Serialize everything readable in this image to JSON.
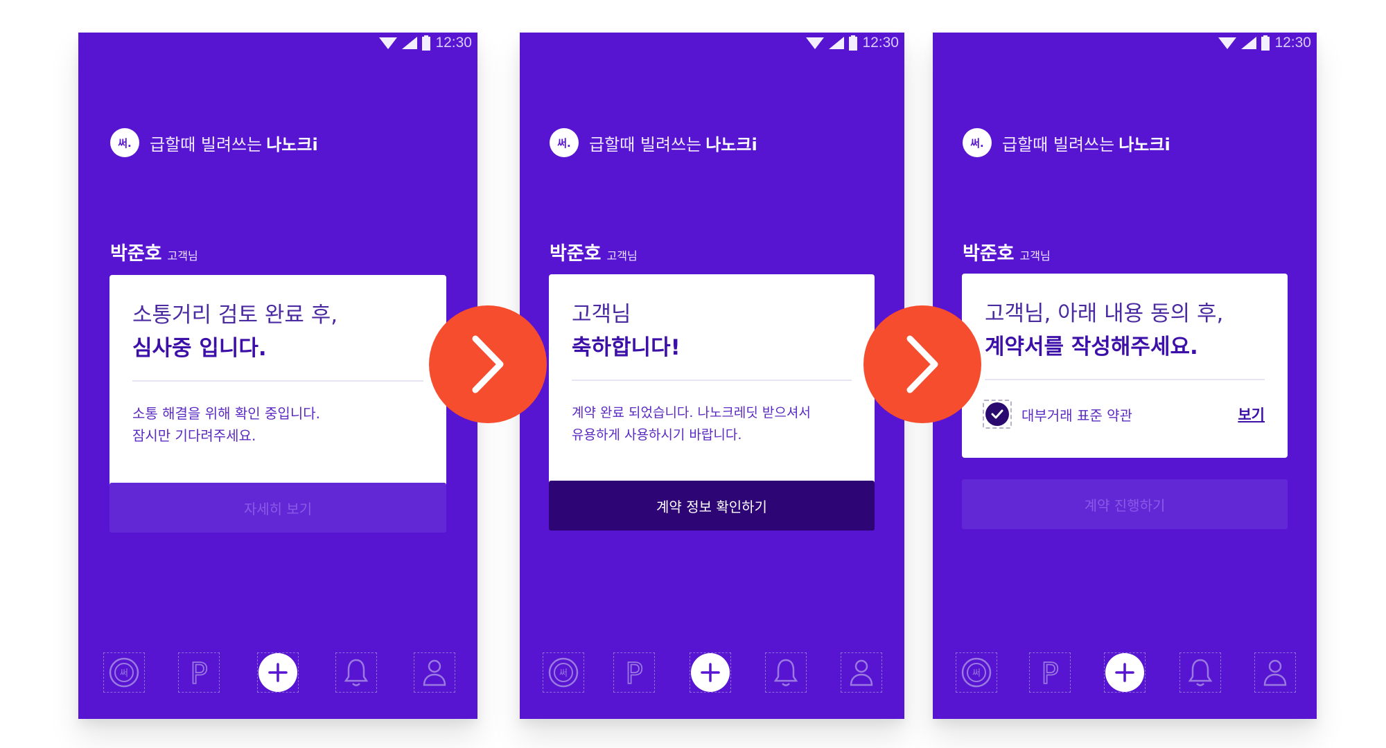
{
  "status": {
    "time": "12:30"
  },
  "brand": {
    "logo": "써.",
    "tagline": "급할때 빌려쓰는",
    "name": "나노크i"
  },
  "customer": {
    "name": "박준호",
    "suffix": "고객님"
  },
  "screens": [
    {
      "card_line1": "소통거리 검토 완료 후,",
      "card_line2": "심사중 입니다.",
      "body_line1": "소통 해결을 위해 확인 중입니다.",
      "body_line2": "잠시만 기다려주세요.",
      "button": "자세히 보기"
    },
    {
      "card_line1": "고객님",
      "card_line2": "축하합니다!",
      "body_line1": "계약 완료 되었습니다. 나노크레딧 받으셔서",
      "body_line2": "유용하게 사용하시기 바랍니다.",
      "button": "계약 정보 확인하기"
    },
    {
      "card_line1": "고객님, 아래 내용 동의 후,",
      "card_line2": "계약서를 작성해주세요.",
      "agree_label": "대부거래 표준 약관",
      "agree_link": "보기",
      "button": "계약 진행하기"
    }
  ],
  "tabbar": {
    "logo_tab_label": "써",
    "parking_tab_label": "P",
    "icons": [
      "logo-icon",
      "parking-icon",
      "plus-icon",
      "bell-icon",
      "person-icon"
    ]
  },
  "colors": {
    "phone_bg": "#5714d1",
    "arrow_bg": "#f64d2e",
    "button_active": "#2e0575",
    "button_disabled": "#6228d6"
  }
}
